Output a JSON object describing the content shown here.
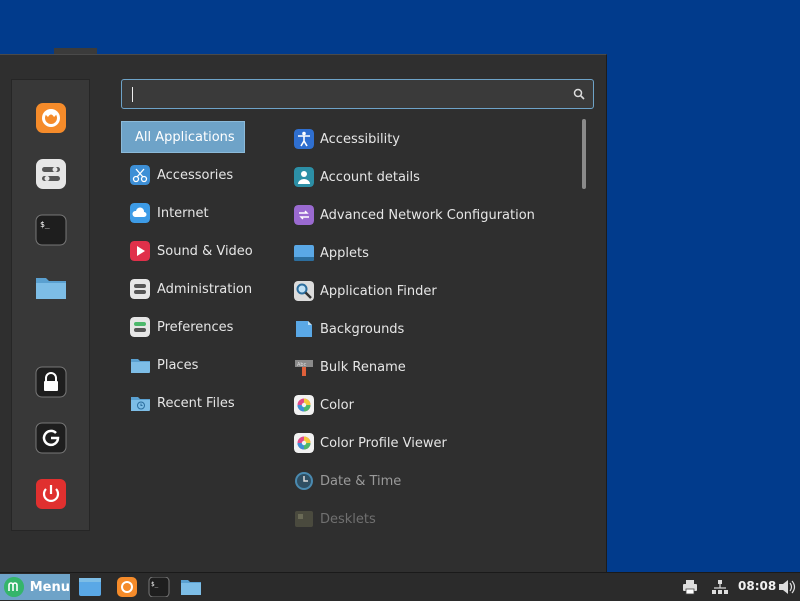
{
  "search": {
    "value": "",
    "placeholder": ""
  },
  "categories": [
    {
      "label": "All Applications",
      "icon": "none"
    },
    {
      "label": "Accessories",
      "icon": "scissors-icon"
    },
    {
      "label": "Internet",
      "icon": "cloud-icon"
    },
    {
      "label": "Sound & Video",
      "icon": "play-icon"
    },
    {
      "label": "Administration",
      "icon": "toggle-icon"
    },
    {
      "label": "Preferences",
      "icon": "switch-icon"
    },
    {
      "label": "Places",
      "icon": "folder-icon"
    },
    {
      "label": "Recent Files",
      "icon": "recent-folder-icon"
    }
  ],
  "apps": [
    {
      "label": "Accessibility",
      "icon": "accessibility-icon"
    },
    {
      "label": "Account details",
      "icon": "user-icon"
    },
    {
      "label": "Advanced Network Configuration",
      "icon": "network-icon"
    },
    {
      "label": "Applets",
      "icon": "applets-icon"
    },
    {
      "label": "Application Finder",
      "icon": "magnifier-icon"
    },
    {
      "label": "Backgrounds",
      "icon": "backgrounds-icon"
    },
    {
      "label": "Bulk Rename",
      "icon": "rename-icon"
    },
    {
      "label": "Color",
      "icon": "color-wheel-icon"
    },
    {
      "label": "Color Profile Viewer",
      "icon": "color-wheel-icon"
    },
    {
      "label": "Date & Time",
      "icon": "clock-icon"
    },
    {
      "label": "Desklets",
      "icon": "desklets-icon"
    }
  ],
  "taskbar": {
    "menu_label": "Menu",
    "clock": "08:08"
  },
  "colors": {
    "accent": "#6ea3c8",
    "desktop": "#013b8c",
    "panel": "#2f2f2f"
  }
}
